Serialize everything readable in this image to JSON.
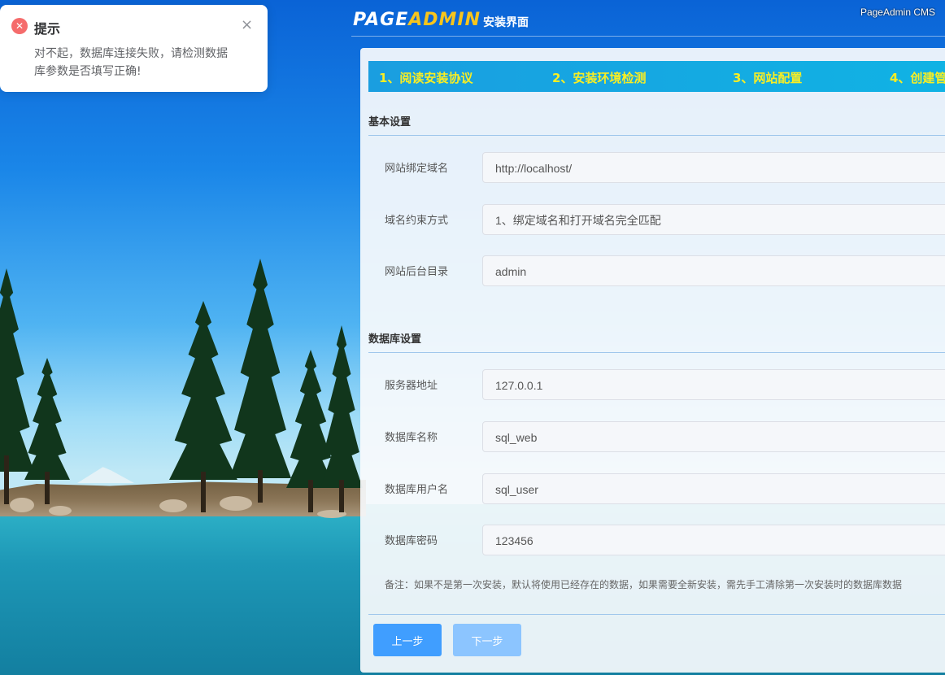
{
  "header": {
    "logo_page": "PAGE",
    "logo_admin": "ADMIN",
    "logo_subtitle": "安装界面",
    "brand": "PageAdmin CMS"
  },
  "steps": [
    {
      "label": "1、阅读安装协议"
    },
    {
      "label": "2、安装环境检测"
    },
    {
      "label": "3、网站配置"
    },
    {
      "label": "4、创建管"
    }
  ],
  "basic": {
    "title": "基本设置",
    "domain_label": "网站绑定域名",
    "domain_value": "http://localhost/",
    "match_label": "域名约束方式",
    "match_value": "1、绑定域名和打开域名完全匹配",
    "admin_label": "网站后台目录",
    "admin_value": "admin"
  },
  "database": {
    "title": "数据库设置",
    "server_label": "服务器地址",
    "server_value": "127.0.0.1",
    "name_label": "数据库名称",
    "name_value": "sql_web",
    "user_label": "数据库用户名",
    "user_value": "sql_user",
    "password_label": "数据库密码",
    "password_value": "123456",
    "note": "备注：如果不是第一次安装，默认将使用已经存在的数据，如果需要全新安装，需先手工清除第一次安装时的数据库数据"
  },
  "buttons": {
    "prev": "上一步",
    "next": "下一步"
  },
  "toast": {
    "title": "提示",
    "message": "对不起，数据库连接失败，请检测数据库参数是否填写正确!",
    "icon": "error-icon",
    "close_icon": "close-icon",
    "color": "#f56c6c"
  },
  "colors": {
    "primary": "#409eff",
    "step_text": "#f9ee23",
    "step_bar": "#1a9ee0"
  }
}
